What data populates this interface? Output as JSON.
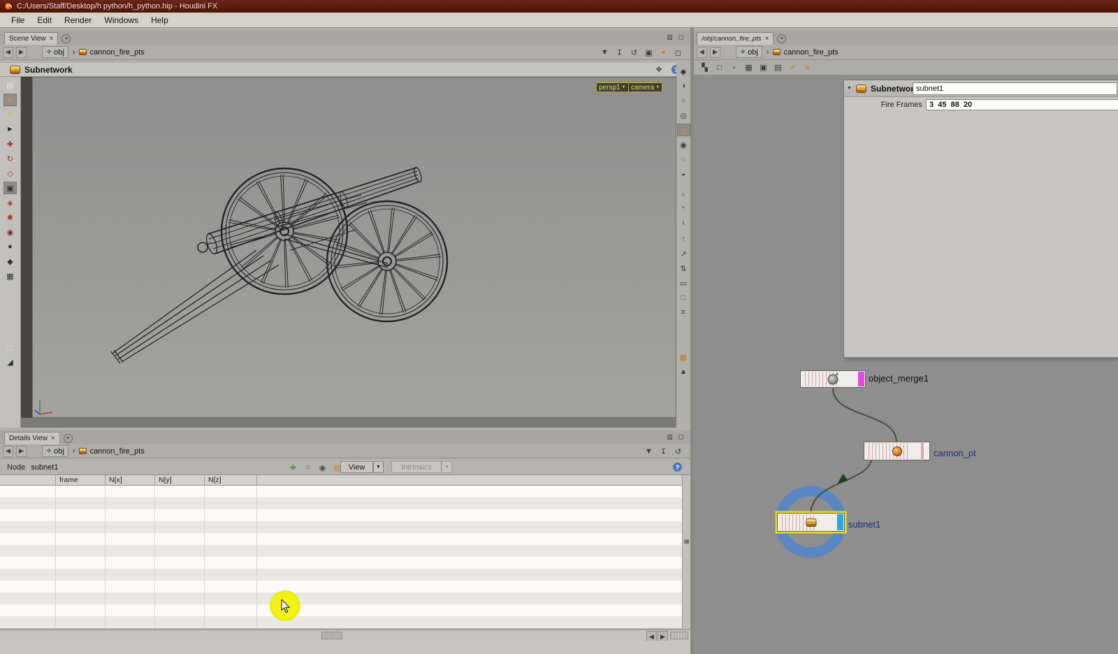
{
  "title_bar": {
    "title": "C:/Users/Staff/Desktop/h python/h_python.hip - Houdini FX"
  },
  "menu_bar": {
    "items": [
      {
        "name": "menu-file",
        "label": "File"
      },
      {
        "name": "menu-edit",
        "label": "Edit"
      },
      {
        "name": "menu-render",
        "label": "Render"
      },
      {
        "name": "menu-windows",
        "label": "Windows"
      },
      {
        "name": "menu-help",
        "label": "Help"
      }
    ]
  },
  "icons": {
    "close": "×",
    "add_tab": "+",
    "help": "?",
    "back": "◀",
    "forward": "▶",
    "crumb_sep": "›",
    "dropdown": "▼",
    "chip_glyph": "❖",
    "grip": ":::",
    "net_glyph": "❖",
    "small_down": "▼",
    "corner_grid": "▦"
  },
  "pane_corner_icons": [
    {
      "name": "pane-split-icon",
      "glyph": "▥"
    },
    {
      "name": "pane-maximize-icon",
      "glyph": "◻"
    }
  ],
  "scene_view": {
    "tab_label": "Scene View",
    "path_root": "obj",
    "path_node": "cannon_fire_pts",
    "header_title": "Subnetwork",
    "persp_label": "persp1",
    "camera_label": "camera",
    "path_icons": [
      {
        "name": "path-dropdown-icon",
        "glyph": "▼"
      },
      {
        "name": "pin-path-icon",
        "glyph": "↧"
      },
      {
        "name": "sync-path-icon",
        "glyph": "↺"
      },
      {
        "name": "clapper-icon",
        "glyph": "▣"
      },
      {
        "name": "render-view-icon",
        "glyph": "●",
        "color": "#e07818"
      },
      {
        "name": "float-pane-icon",
        "glyph": "◻"
      }
    ],
    "left_toolbar": [
      {
        "name": "pose-library-icon",
        "glyph": "▤",
        "color": "#e8e4d4"
      },
      {
        "name": "view-tool-icon",
        "glyph": "●",
        "color": "#e8881a",
        "bg": "#908e8a"
      },
      {
        "name": "edit-tool-icon",
        "glyph": "✎",
        "color": "#dcbc1e"
      },
      {
        "name": "select-tool-icon",
        "glyph": "►",
        "color": "#242424"
      },
      {
        "name": "move-tool-icon",
        "glyph": "✚",
        "color": "#a83424"
      },
      {
        "name": "rotate-tool-icon",
        "glyph": "↻",
        "color": "#a83424"
      },
      {
        "name": "scale-tool-icon",
        "glyph": "◇",
        "color": "#a83424"
      },
      {
        "name": "handles-tool-icon",
        "glyph": "▣",
        "color": "#2e2e2e",
        "bg": "#908e8a"
      },
      {
        "name": "paint-tool-icon",
        "glyph": "◈",
        "color": "#a83424"
      },
      {
        "name": "sculpt-tool-icon",
        "glyph": "✱",
        "color": "#a83424"
      },
      {
        "name": "mask-tool-icon",
        "glyph": "◉",
        "color": "#7c241c"
      },
      {
        "name": "sphere-primitive-icon",
        "glyph": "●",
        "color": "#2e2e2e"
      },
      {
        "name": "bone-tool-icon",
        "glyph": "◆",
        "color": "#2e2e2e"
      },
      {
        "name": "box-primitive-icon",
        "glyph": "▦",
        "color": "#2e2e2e"
      },
      {
        "spacer": 78
      },
      {
        "name": "grab-view-icon",
        "glyph": "◻",
        "color": "#ded8c8"
      },
      {
        "name": "snap-gravity-icon",
        "glyph": "◢",
        "color": "#2e2e2e"
      }
    ],
    "right_toolbar": [
      {
        "name": "view-layout-icon",
        "glyph": "◆"
      },
      {
        "name": "shading-mode-icon",
        "glyph": "◑"
      },
      {
        "name": "wireframe-icon",
        "glyph": "○"
      },
      {
        "name": "smooth-shade-icon",
        "glyph": "◎"
      },
      {
        "name": "display-options-icon",
        "glyph": "▲",
        "color": "#d8821a",
        "bg": "#8e8c88"
      },
      {
        "name": "ghost-objects-icon",
        "glyph": "◉"
      },
      {
        "name": "hidden-line-icon",
        "glyph": "◌"
      },
      {
        "name": "template-display-icon",
        "glyph": "◒"
      },
      {
        "spacer": 6
      },
      {
        "name": "group-select-icon",
        "glyph": "▫"
      },
      {
        "name": "point-markers-icon",
        "glyph": "°"
      },
      {
        "name": "point-numbers-icon",
        "glyph": "¹"
      },
      {
        "name": "normals-display-icon",
        "glyph": "↑"
      },
      {
        "name": "vector-display-icon",
        "glyph": "↗"
      },
      {
        "name": "fit-view-icon",
        "glyph": "⇅"
      },
      {
        "name": "camera-view-icon",
        "glyph": "▭"
      },
      {
        "name": "snapshot-icon",
        "glyph": "□"
      },
      {
        "name": "character-picker-icon",
        "glyph": "≡"
      },
      {
        "spacer": 40
      },
      {
        "name": "quad-view-icon",
        "glyph": "▦",
        "color": "#c87818"
      },
      {
        "name": "scroll-more-icon",
        "glyph": "▲"
      }
    ]
  },
  "details_view": {
    "tab_label": "Details View",
    "path_root": "obj",
    "path_node": "cannon_fire_pts",
    "node_label": "Node",
    "node_name": "subnet1",
    "view_button": "View",
    "intrinsics_button": "Intrinsics",
    "path_icons": [
      {
        "name": "path-dropdown-icon",
        "glyph": "▼"
      },
      {
        "name": "pin-path-icon",
        "glyph": "↧"
      },
      {
        "name": "sync-path-icon",
        "glyph": "↺"
      }
    ],
    "toolbar_icons": [
      {
        "name": "cook-mode-icon",
        "glyph": "✚",
        "color": "#5a9a30"
      },
      {
        "name": "points-mode-icon",
        "glyph": "○",
        "color": "#4a4a4a"
      },
      {
        "name": "prims-mode-icon",
        "glyph": "◉",
        "color": "#4a4a4a"
      },
      {
        "name": "detail-mode-icon",
        "glyph": "▤",
        "color": "#d0781a"
      }
    ],
    "table": {
      "columns": [
        "",
        "frame",
        "N[x]",
        "N[y]",
        "N[z]"
      ],
      "empty_rows": 12
    }
  },
  "network_view": {
    "tab_label": "/obj/cannon_fire_pts",
    "path_root": "obj",
    "path_node": "cannon_fire_pts",
    "toolbar": [
      {
        "name": "snap-grid-icon",
        "glyph": "▚"
      },
      {
        "name": "frame-all-icon",
        "glyph": "□"
      },
      {
        "name": "frame-selected-icon",
        "glyph": "▫"
      },
      {
        "name": "layout-nodes-icon",
        "glyph": "▦"
      },
      {
        "name": "node-thumbs-icon",
        "glyph": "▣"
      },
      {
        "name": "node-gallery-icon",
        "glyph": "▤"
      },
      {
        "name": "checkmark-icon",
        "glyph": "✔",
        "color": "#b89a10"
      },
      {
        "name": "subnet-badge-icon",
        "glyph": "≡",
        "color": "#d0781a"
      }
    ],
    "parameters": {
      "header_title": "Subnetwork",
      "node_name": "subnet1",
      "fire_frames_label": "Fire Frames",
      "fire_frames_value": "3  45  88  20"
    },
    "nodes": [
      {
        "name": "object_merge1"
      },
      {
        "name": "cannon_pt"
      },
      {
        "name": "subnet1"
      }
    ]
  },
  "colors": {
    "accent_orange": "#d87020",
    "selection_yellow": "#e6da1c",
    "display_flag_blue": "#28a8e8",
    "render_flag_magenta": "#e24ae2",
    "wire_green": "#41503c",
    "ring_blue": "#5b86c4",
    "network_bg": "#8e8e8e"
  }
}
